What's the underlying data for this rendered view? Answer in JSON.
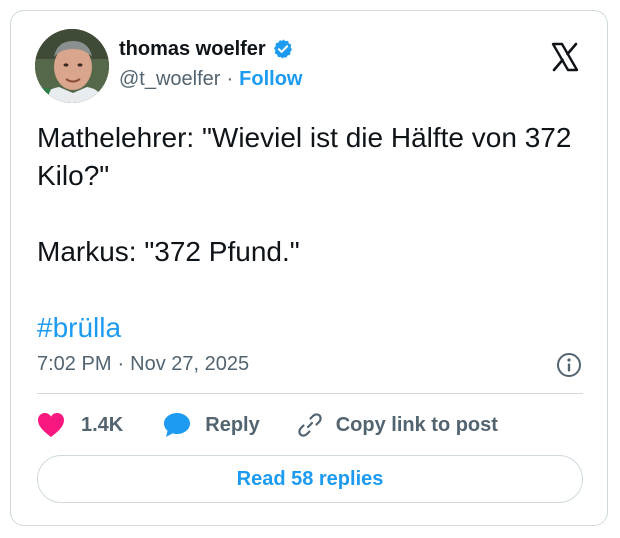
{
  "author": {
    "name": "thomas woelfer",
    "handle": "@t_woelfer",
    "separator": "·",
    "follow_label": "Follow",
    "verified_icon": "verified-badge-icon",
    "avatar_icon": "avatar"
  },
  "platform_icon": "x-logo-icon",
  "tweet": {
    "line1": "Mathelehrer: \"Wieviel ist die Hälfte von 372 Kilo?\"",
    "line2": "Markus: \"372 Pfund.\"",
    "hashtag": "#brülla"
  },
  "meta": {
    "time": "7:02 PM",
    "separator": "·",
    "date": "Nov 27, 2025",
    "info_icon": "info-icon"
  },
  "actions": {
    "likes": "1.4K",
    "reply_label": "Reply",
    "copy_label": "Copy link to post",
    "like_icon": "heart-icon",
    "reply_icon": "speech-bubble-icon",
    "copy_icon": "link-icon"
  },
  "read_replies_label": "Read 58 replies",
  "colors": {
    "accent": "#1d9bf0",
    "heart": "#f91880",
    "text": "#0f1419",
    "secondary": "#536471",
    "border": "#cfd9de"
  }
}
